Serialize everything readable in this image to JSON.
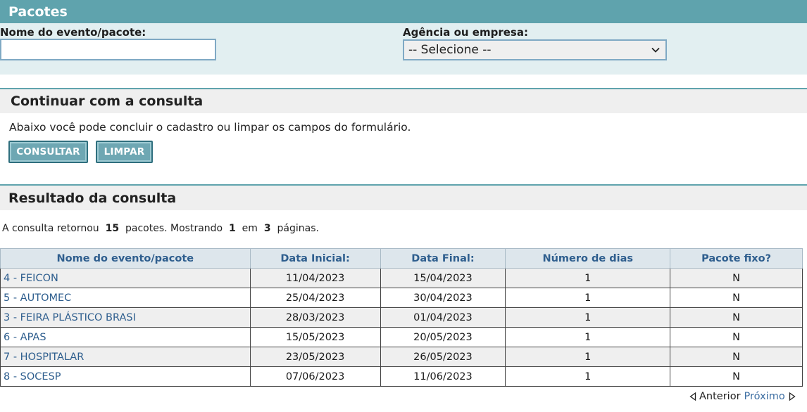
{
  "header": {
    "title": "Pacotes"
  },
  "filters": {
    "event_label": "Nome do evento/pacote:",
    "event_value": "",
    "agency_label": "Agência ou empresa:",
    "agency_selected": "-- Selecione --"
  },
  "continue_section": {
    "title": "Continuar com a consulta",
    "description": "Abaixo você pode concluir o cadastro ou limpar os campos do formulário.",
    "consult_button": "CONSULTAR",
    "clear_button": "LIMPAR"
  },
  "results_section": {
    "title": "Resultado da consulta",
    "summary": {
      "prefix": "A consulta retornou",
      "total": "15",
      "mid": "pacotes. Mostrando",
      "page": "1",
      "of": "em",
      "pages": "3",
      "suffix": "páginas."
    },
    "columns": [
      "Nome do evento/pacote",
      "Data Inicial:",
      "Data Final:",
      "Número de dias",
      "Pacote fixo?"
    ],
    "rows": [
      [
        "4 - FEICON",
        "11/04/2023",
        "15/04/2023",
        "1",
        "N"
      ],
      [
        "5 - AUTOMEC",
        "25/04/2023",
        "30/04/2023",
        "1",
        "N"
      ],
      [
        "3 - FEIRA PLÁSTICO BRASI",
        "28/03/2023",
        "01/04/2023",
        "1",
        "N"
      ],
      [
        "6 - APAS",
        "15/05/2023",
        "20/05/2023",
        "1",
        "N"
      ],
      [
        "7 - HOSPITALAR",
        "23/05/2023",
        "26/05/2023",
        "1",
        "N"
      ],
      [
        "8 - SOCESP",
        "07/06/2023",
        "11/06/2023",
        "1",
        "N"
      ]
    ],
    "pager": {
      "previous": "Anterior",
      "next": "Próximo"
    }
  }
}
